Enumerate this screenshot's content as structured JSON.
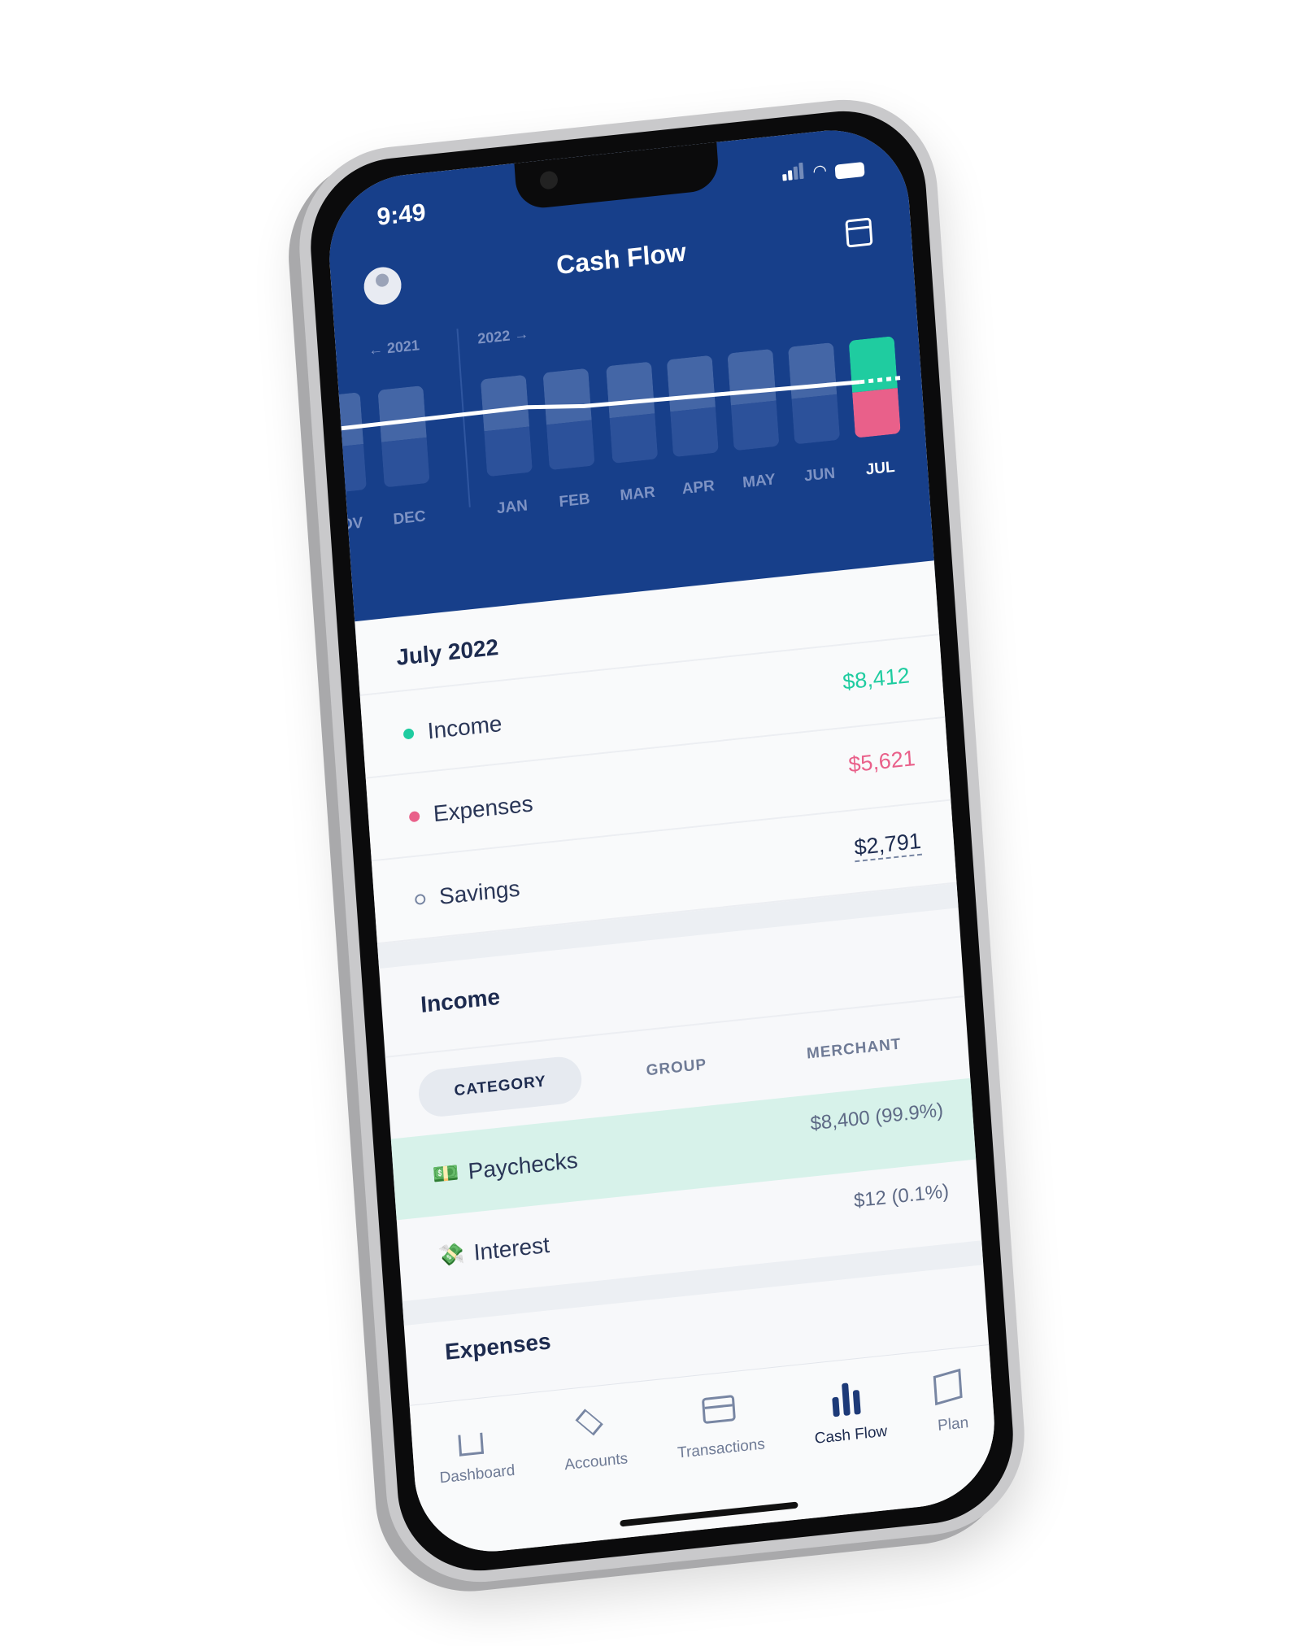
{
  "status": {
    "time": "9:49"
  },
  "header": {
    "title": "Cash Flow",
    "prev_year": "← 2021",
    "next_year": "2022 →"
  },
  "chart_data": {
    "type": "bar",
    "categories": [
      "NOV",
      "DEC",
      "JAN",
      "FEB",
      "MAR",
      "APR",
      "MAY",
      "JUN",
      "JUL"
    ],
    "selected": "JUL",
    "series": [
      {
        "name": "Income",
        "color": "#1fcca0"
      },
      {
        "name": "Expenses",
        "color": "#e9608a"
      }
    ],
    "selected_values": {
      "income": 8412,
      "expenses": 5621,
      "savings": 2791
    }
  },
  "summary": {
    "month": "July 2022",
    "rows": [
      {
        "label": "Income",
        "amount": "$8,412",
        "color": "#1fcca0"
      },
      {
        "label": "Expenses",
        "amount": "$5,621",
        "color": "#e9608a"
      },
      {
        "label": "Savings",
        "amount": "$2,791",
        "color": "#1d2b4f"
      }
    ]
  },
  "income": {
    "title": "Income",
    "tabs": [
      "CATEGORY",
      "GROUP",
      "MERCHANT"
    ],
    "categories": [
      {
        "emoji": "💵",
        "name": "Paychecks",
        "value": "$8,400 (99.9%)"
      },
      {
        "emoji": "💸",
        "name": "Interest",
        "value": "$12 (0.1%)"
      }
    ]
  },
  "expenses": {
    "title": "Expenses"
  },
  "tabbar": [
    {
      "label": "Dashboard",
      "icon": "home-icon"
    },
    {
      "label": "Accounts",
      "icon": "layers-icon"
    },
    {
      "label": "Transactions",
      "icon": "credit-card-icon"
    },
    {
      "label": "Cash Flow",
      "icon": "bar-chart-icon",
      "active": true
    },
    {
      "label": "Plan",
      "icon": "map-icon"
    }
  ]
}
